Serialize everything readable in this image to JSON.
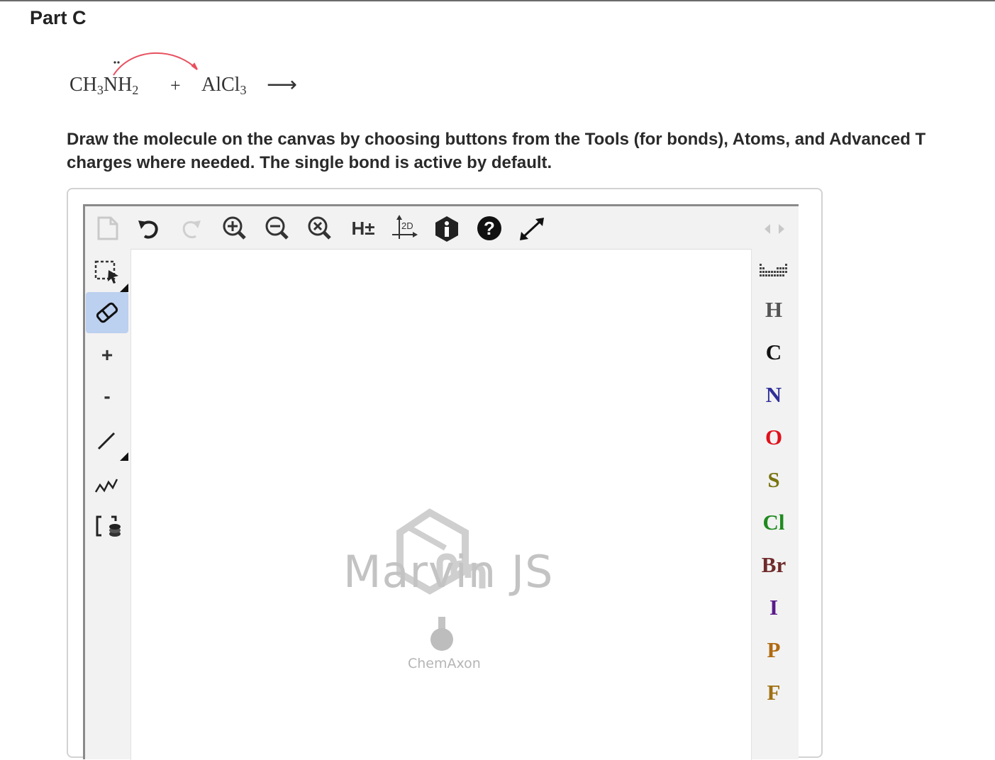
{
  "part": {
    "title": "Part C"
  },
  "equation": {
    "reactant1_main": "CH",
    "reactant1_sub1": "3",
    "reactant1_n": "N",
    "reactant1_h": "H",
    "reactant1_sub2": "2",
    "plus": "+",
    "reactant2_main": "AlCl",
    "reactant2_sub": "3",
    "arrow": "⟶"
  },
  "instructions": {
    "line1": "Draw the molecule on the canvas by choosing buttons from the Tools (for bonds), Atoms, and Advanced T",
    "line2": "charges where needed. The single bond is active by default."
  },
  "toolbar": {
    "hydrogen_label": "H±",
    "clean2d_label": "2D"
  },
  "left_tools": {
    "charge_plus_label": "+",
    "charge_minus_label": "-"
  },
  "atoms": [
    "H",
    "C",
    "N",
    "O",
    "S",
    "Cl",
    "Br",
    "I",
    "P",
    "F"
  ],
  "atom_colors": {
    "H": "#555555",
    "C": "#111111",
    "N": "#2f2f9a",
    "O": "#e0101a",
    "S": "#7a7410",
    "Cl": "#1f8a1f",
    "Br": "#6e2a2a",
    "I": "#5b1a8a",
    "P": "#b06a10",
    "F": "#a07010"
  },
  "canvas": {
    "brand": "Marvin JS",
    "vendor": "ChemAxon"
  },
  "colors": {
    "active_tool_bg": "#bcd0ef",
    "curved_arrow": "#e8505f"
  }
}
